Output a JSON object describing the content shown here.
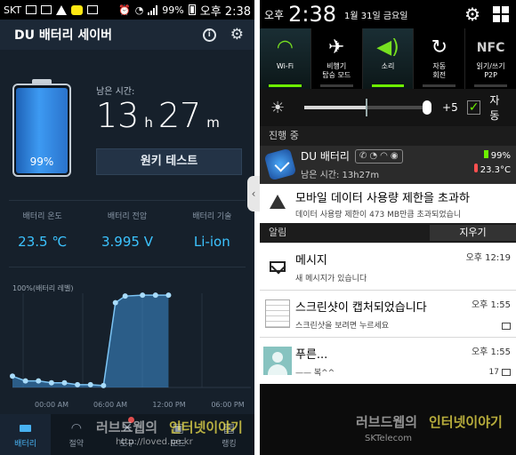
{
  "left": {
    "status_bar": {
      "carrier": "SKT",
      "battery_pct": "99%",
      "clock": "오후 2:38"
    },
    "header": {
      "title": "DU 배터리 세이버"
    },
    "battery": {
      "level": 0.99,
      "label": "99%",
      "fill_color": "#3d9af2"
    },
    "remaining": {
      "label": "남은 시간:",
      "hours": "13",
      "h_unit": "h",
      "minutes": "27",
      "m_unit": "m"
    },
    "test_button": "원키 테스트",
    "stats": [
      {
        "label": "배터리 온도",
        "value": "23.5 ℃"
      },
      {
        "label": "배터리 전압",
        "value": "3.995 V"
      },
      {
        "label": "배터리 기술",
        "value": "Li-ion"
      }
    ],
    "nav": [
      {
        "label": "배터리",
        "icon": "battery-icon"
      },
      {
        "label": "절약",
        "icon": "gauge-icon"
      },
      {
        "label": "도구",
        "icon": "tools-icon"
      },
      {
        "label": "모드",
        "icon": "mode-icon"
      },
      {
        "label": "랭킹",
        "icon": "ranking-icon"
      }
    ],
    "watermark": {
      "brand_a": "러브드웹의",
      "brand_b": "인터넷이야기",
      "url": "http://loved.pe.kr"
    }
  },
  "chart_data": {
    "type": "area",
    "ylabel": "100%(배터리 레벨)",
    "x_ticks": [
      "00:00 AM",
      "06:00 AM",
      "12:00 PM",
      "06:00 PM"
    ],
    "x": [
      0,
      1.2,
      2.4,
      3.6,
      4.8,
      6.0,
      7.2,
      8.4,
      9.5,
      10.4,
      12.0,
      13.2,
      14.4
    ],
    "values": [
      12,
      7,
      7,
      5,
      5,
      3,
      3,
      2,
      90,
      97,
      98,
      98,
      98
    ],
    "ylim": [
      0,
      100
    ],
    "xlim": [
      0,
      22
    ],
    "color": "#3e8fd6"
  },
  "right": {
    "header": {
      "ampm": "오후",
      "time": "2:38",
      "date": "1월 31일 금요일"
    },
    "quick_settings": [
      {
        "label": "Wi-Fi",
        "icon": "wifi-icon",
        "on": true
      },
      {
        "label": "비행기\n탑승 모드",
        "icon": "airplane-icon",
        "on": false
      },
      {
        "label": "소리",
        "icon": "speaker-icon",
        "on": true
      },
      {
        "label": "자동\n회전",
        "icon": "rotate-icon",
        "on": false
      },
      {
        "label": "읽기/쓰기\nP2P",
        "icon": "nfc-icon",
        "glyph": "NFC",
        "on": false
      }
    ],
    "brightness": {
      "level": 0.5,
      "offset": "+5",
      "auto_label": "자동",
      "auto_checked": true
    },
    "ongoing_label": "진행 중",
    "du_item": {
      "title": "DU 배터리",
      "subtitle": "남은 시간: 13h27m",
      "battery": "99%",
      "temp": "23.3°C"
    },
    "warning": {
      "title": "모바일 데이터 사용량 제한을 초과하",
      "sub": "데이터 사용량 제한이 473 MB만큼 초과되었습니"
    },
    "alerts_label": "알림",
    "clear_button": "지우기",
    "notifications": [
      {
        "title": "메시지",
        "sub": "새 메시지가 있습니다",
        "time": "오후 12:19",
        "icon": "envelope-icon"
      },
      {
        "title": "스크린샷이 캡처되었습니다",
        "sub": "스크린샷을 보려면 누르세요",
        "time": "오후 1:55",
        "icon": "screenshot-thumb"
      },
      {
        "title": "푸른...",
        "sub": "—— 복^^",
        "time": "오후 1:55",
        "count": "17",
        "icon": "avatar"
      }
    ],
    "watermark": {
      "brand_a": "러브드웹의",
      "brand_b": "인터넷이야기",
      "carrier": "SKTelecom"
    }
  }
}
